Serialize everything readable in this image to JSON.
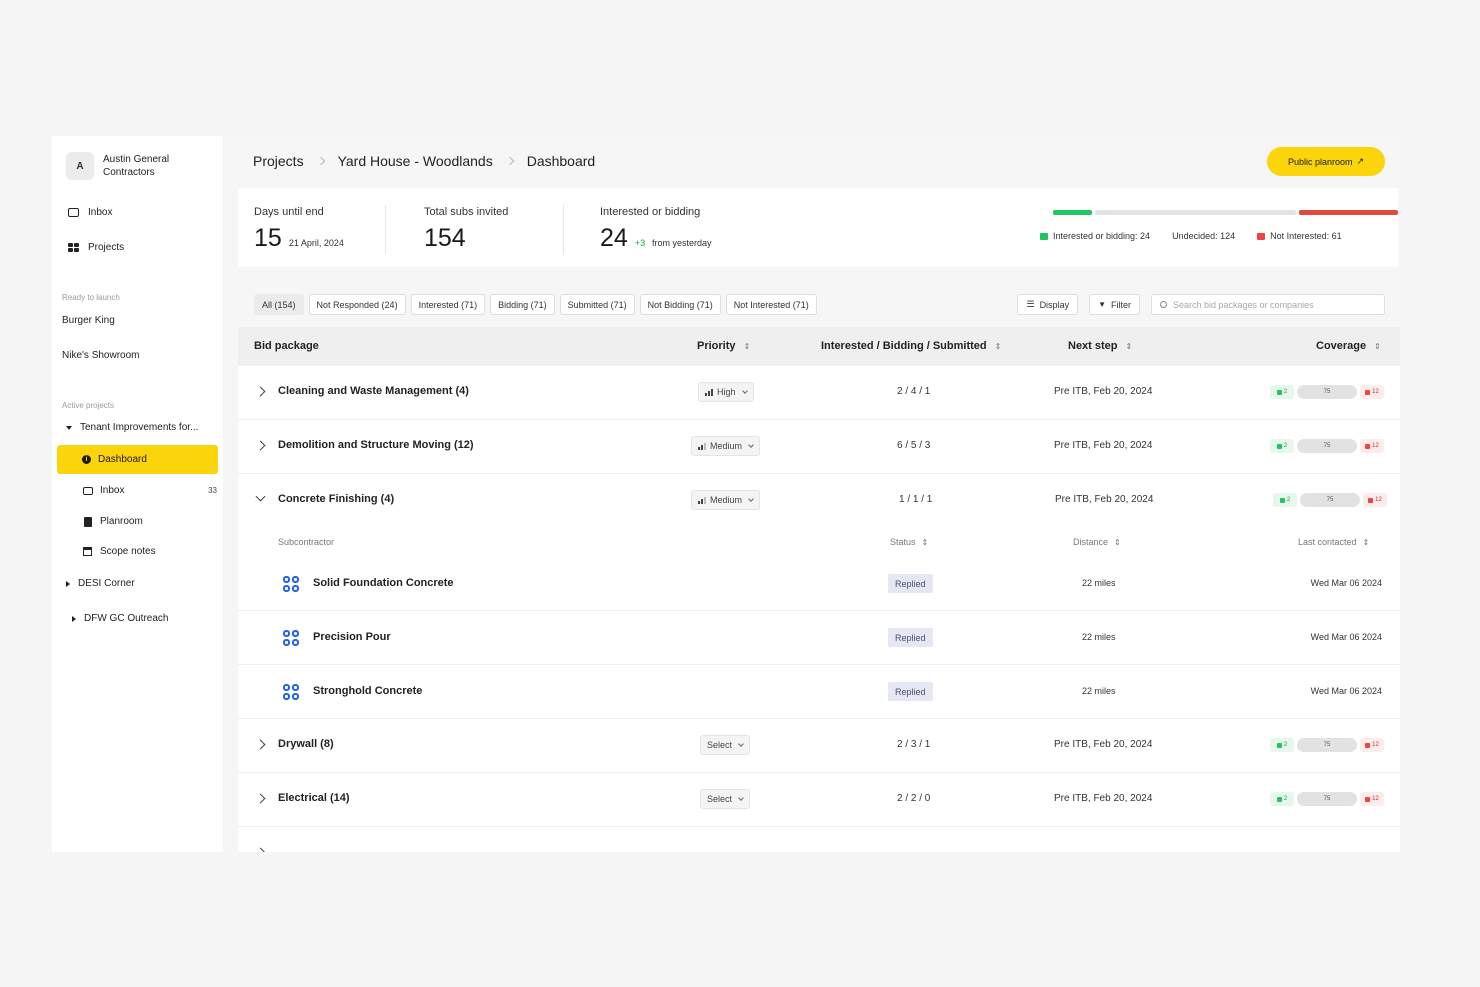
{
  "org": {
    "avatar": "A",
    "name": "Austin General Contractors"
  },
  "nav": {
    "inbox": "Inbox",
    "projects": "Projects"
  },
  "ready_label": "Ready to launch",
  "ready_projects": [
    "Burger King",
    "Nike's Showroom"
  ],
  "active_label": "Active projects",
  "active_project": "Tenant Improvements for...",
  "project_nav": {
    "dashboard": "Dashboard",
    "inbox": "Inbox",
    "inbox_count": "33",
    "planroom": "Planroom",
    "scope_notes": "Scope notes"
  },
  "other_projects": [
    "DESI Corner",
    "DFW GC Outreach"
  ],
  "breadcrumb": [
    "Projects",
    "Yard House - Woodlands",
    "Dashboard"
  ],
  "public_planroom": "Public planroom",
  "stats": {
    "days_label": "Days until end",
    "days_value": "15",
    "days_date": "21 April, 2024",
    "subs_label": "Total subs invited",
    "subs_value": "154",
    "interested_label": "Interested or bidding",
    "interested_value": "24",
    "interested_delta": "+3",
    "interested_delta_text": "from yesterday"
  },
  "progress": {
    "interested": 24,
    "undecided": 124,
    "not_interested": 61,
    "colors": {
      "interested": "#22c55e",
      "undecided": "#e3e3e3",
      "not_interested": "#e04a3a"
    }
  },
  "legend": {
    "interested": "Interested or bidding: 24",
    "undecided": "Undecided: 124",
    "not_interested": "Not Interested: 61"
  },
  "filters": [
    "All (154)",
    "Not Responded (24)",
    "Interested (71)",
    "Bidding (71)",
    "Submitted (71)",
    "Not Bidding (71)",
    "Not Interested (71)"
  ],
  "tools": {
    "display": "Display",
    "filter": "Filter",
    "search_placeholder": "Search bid packages or companies"
  },
  "columns": {
    "bid_package": "Bid package",
    "priority": "Priority",
    "ibs": "Interested / Bidding / Submitted",
    "next_step": "Next step",
    "coverage": "Coverage"
  },
  "rows": [
    {
      "name": "Cleaning and Waste Management (4)",
      "priority": "High",
      "ibs": "2 / 4 / 1",
      "next": "Pre ITB, Feb 20, 2024",
      "cov_up": "2",
      "cov_mid": "75",
      "cov_down": "12"
    },
    {
      "name": "Demolition and Structure Moving (12)",
      "priority": "Medium",
      "ibs": "6 / 5 / 3",
      "next": "Pre ITB, Feb 20, 2024",
      "cov_up": "2",
      "cov_mid": "75",
      "cov_down": "12"
    },
    {
      "name": "Concrete Finishing (4)",
      "priority": "Medium",
      "ibs": "1 / 1 / 1",
      "next": "Pre ITB, Feb 20, 2024",
      "cov_up": "2",
      "cov_mid": "75",
      "cov_down": "12"
    },
    {
      "name": "Drywall (8)",
      "priority": "Select",
      "ibs": "2 / 3 / 1",
      "next": "Pre ITB, Feb 20, 2024",
      "cov_up": "2",
      "cov_mid": "75",
      "cov_down": "12"
    },
    {
      "name": "Electrical (14)",
      "priority": "Select",
      "ibs": "2 / 2 / 0",
      "next": "Pre ITB, Feb 20, 2024",
      "cov_up": "2",
      "cov_mid": "75",
      "cov_down": "12"
    }
  ],
  "sub_columns": {
    "subcontractor": "Subcontractor",
    "status": "Status",
    "distance": "Distance",
    "last_contacted": "Last contacted"
  },
  "subcontractors": [
    {
      "name": "Solid Foundation Concrete",
      "status": "Replied",
      "distance": "22 miles",
      "last": "Wed Mar 06 2024"
    },
    {
      "name": "Precision Pour",
      "status": "Replied",
      "distance": "22 miles",
      "last": "Wed Mar 06 2024"
    },
    {
      "name": "Stronghold Concrete",
      "status": "Replied",
      "distance": "22 miles",
      "last": "Wed Mar 06 2024"
    }
  ]
}
